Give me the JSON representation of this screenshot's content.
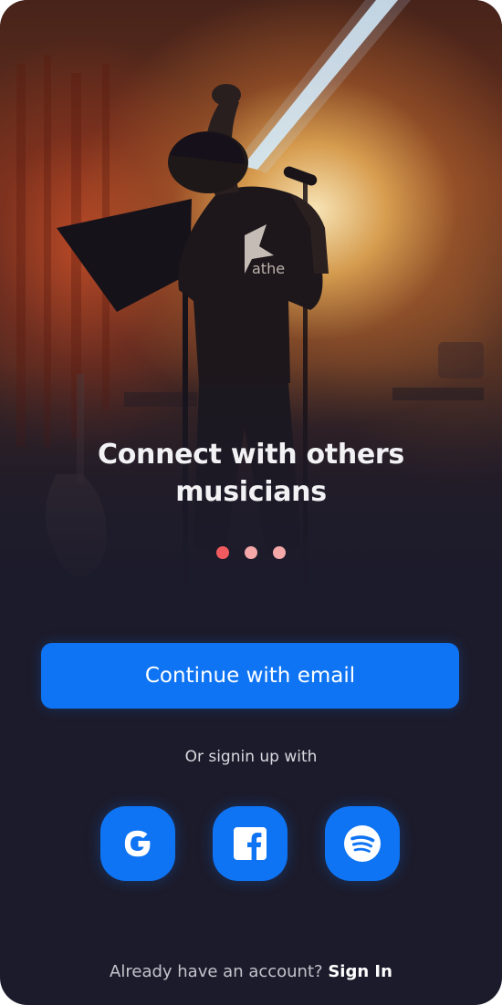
{
  "hero": {
    "headline_line1": "Connect with others",
    "headline_line2": "musicians",
    "carousel": {
      "total": 3,
      "active_index": 0,
      "active_color": "#f15b5f",
      "inactive_color": "#f4a8a8"
    }
  },
  "actions": {
    "continue_email_label": "Continue with email",
    "or_text": "Or signin up with",
    "social": [
      {
        "name": "Google",
        "icon": "google-icon"
      },
      {
        "name": "Facebook",
        "icon": "facebook-icon"
      },
      {
        "name": "Spotify",
        "icon": "spotify-icon"
      }
    ]
  },
  "footer": {
    "prompt": "Already have an account?",
    "signin_label": "Sign In"
  },
  "colors": {
    "accent": "#0e74f3",
    "background": "#1c1b2b",
    "text_primary": "#ffffff",
    "text_secondary": "#c4c4cc"
  }
}
